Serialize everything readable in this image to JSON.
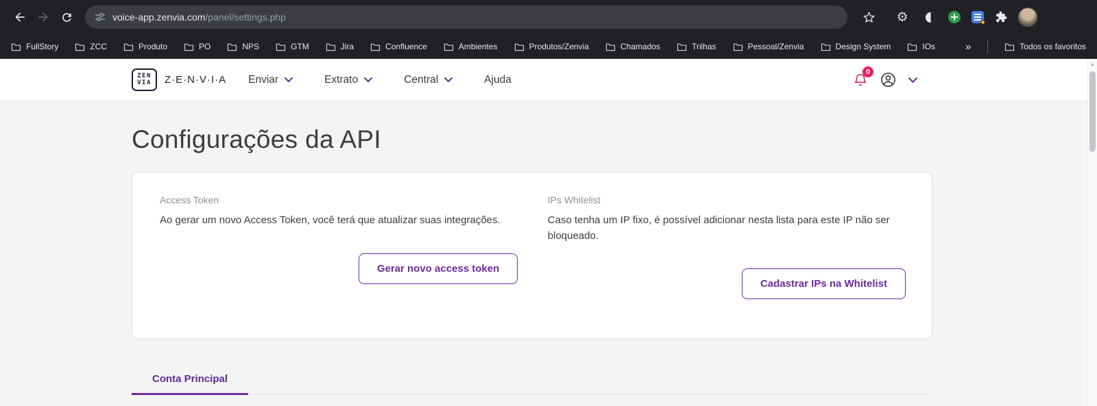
{
  "browser": {
    "url": {
      "domain": "voice-app.zenvia.com",
      "path": "/panel/settings.php"
    },
    "bookmarks": [
      "FullStory",
      "ZCC",
      "Produto",
      "PO",
      "NPS",
      "GTM",
      "Jira",
      "Confluence",
      "Ambientes",
      "Produtos/Zenvia",
      "Chamados",
      "Trilhas",
      "Pessoal/Zenvia",
      "Design System",
      "IOs"
    ],
    "overflow_chevron": "»",
    "all_bookmarks_label": "Todos os favoritos"
  },
  "header": {
    "logo_line1": "ZEN",
    "logo_line2": "VIA",
    "brand": "Z·E·N·V·I·A",
    "nav": [
      {
        "label": "Enviar"
      },
      {
        "label": "Extrato"
      },
      {
        "label": "Central"
      },
      {
        "label": "Ajuda"
      }
    ],
    "notification_count": "0"
  },
  "page": {
    "title": "Configurações da API",
    "access_token": {
      "label": "Access Token",
      "description": "Ao gerar um novo Access Token, você terá que atualizar suas integrações.",
      "button_label": "Gerar novo access token"
    },
    "whitelist": {
      "label": "IPs Whitelist",
      "description": "Caso tenha um IP fixo, é possível adicionar nesta lista para este IP não ser bloqueado.",
      "button_label": "Cadastrar IPs na Whitelist"
    },
    "tabs": [
      {
        "label": "Conta Principal"
      }
    ]
  },
  "colors": {
    "accent_purple": "#6e2b9c",
    "notification_pink": "#e91e63",
    "browser_dark": "#202124",
    "page_background": "#f4f4f5"
  }
}
